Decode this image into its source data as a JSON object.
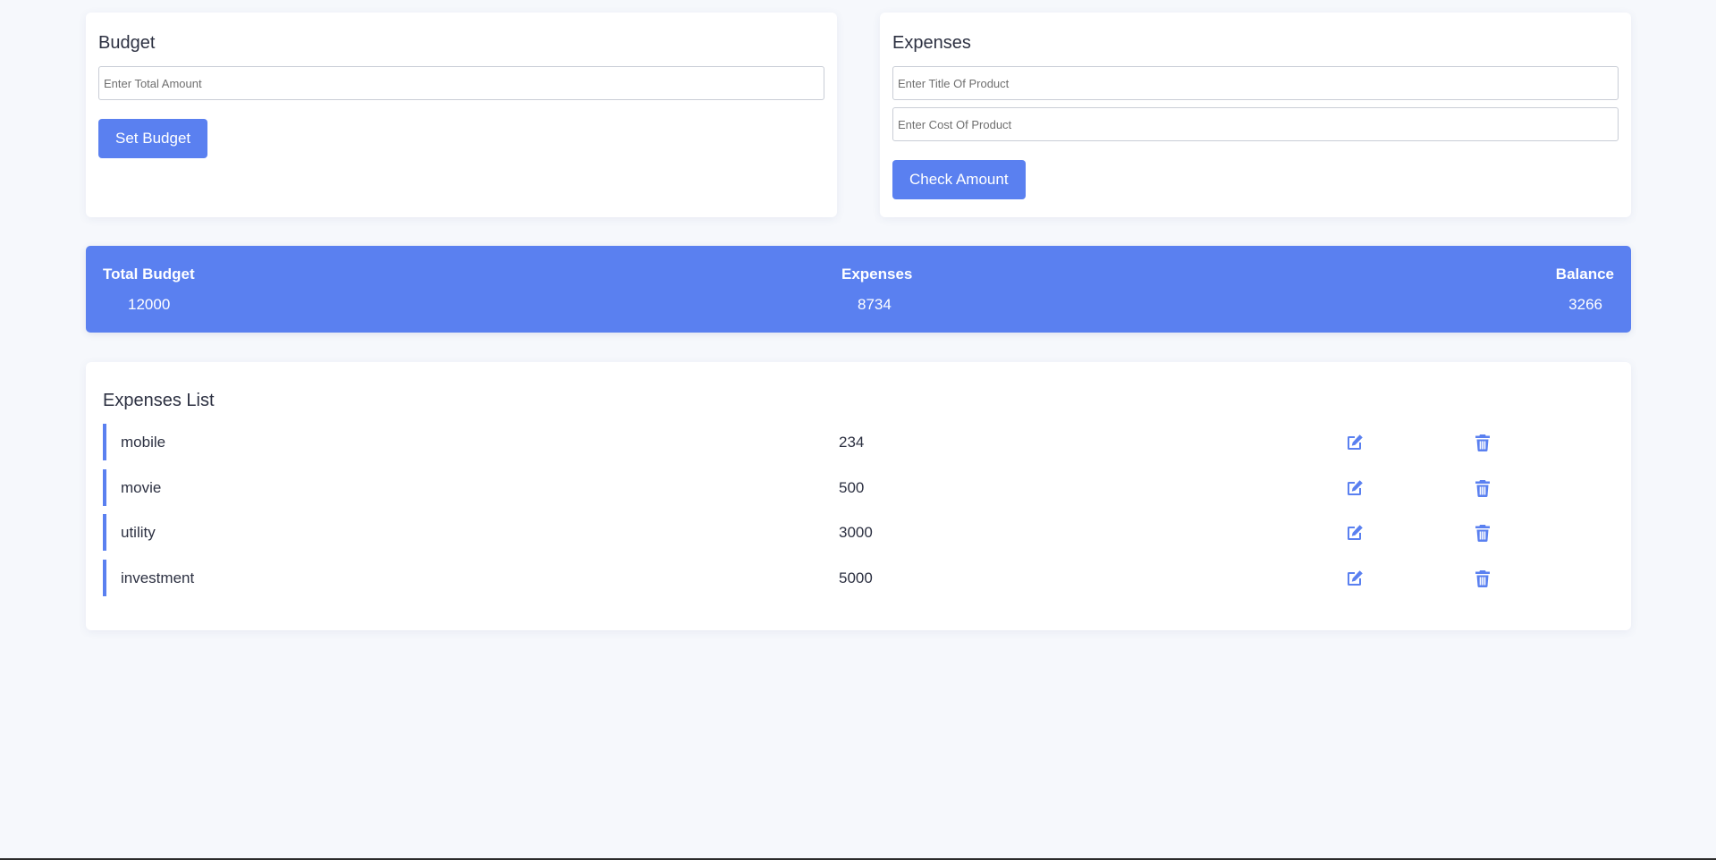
{
  "budget": {
    "title": "Budget",
    "amount_placeholder": "Enter Total Amount",
    "amount_value": "",
    "set_button": "Set Budget"
  },
  "expenses_form": {
    "title": "Expenses",
    "title_placeholder": "Enter Title Of Product",
    "cost_placeholder": "Enter Cost Of Product",
    "check_button": "Check Amount"
  },
  "summary": {
    "total_label": "Total Budget",
    "total_value": "12000",
    "expenses_label": "Expenses",
    "expenses_value": "8734",
    "balance_label": "Balance",
    "balance_value": "3266"
  },
  "expenses_list": {
    "title": "Expenses List",
    "items": [
      {
        "title": "mobile",
        "amount": "234"
      },
      {
        "title": "movie",
        "amount": "500"
      },
      {
        "title": "utility",
        "amount": "3000"
      },
      {
        "title": "investment",
        "amount": "5000"
      }
    ]
  },
  "icons": {
    "edit": "edit-icon",
    "delete": "trash-icon"
  },
  "colors": {
    "accent": "#5a80f0",
    "background": "#f6f8fc",
    "card": "#ffffff",
    "text": "#2d3142"
  }
}
